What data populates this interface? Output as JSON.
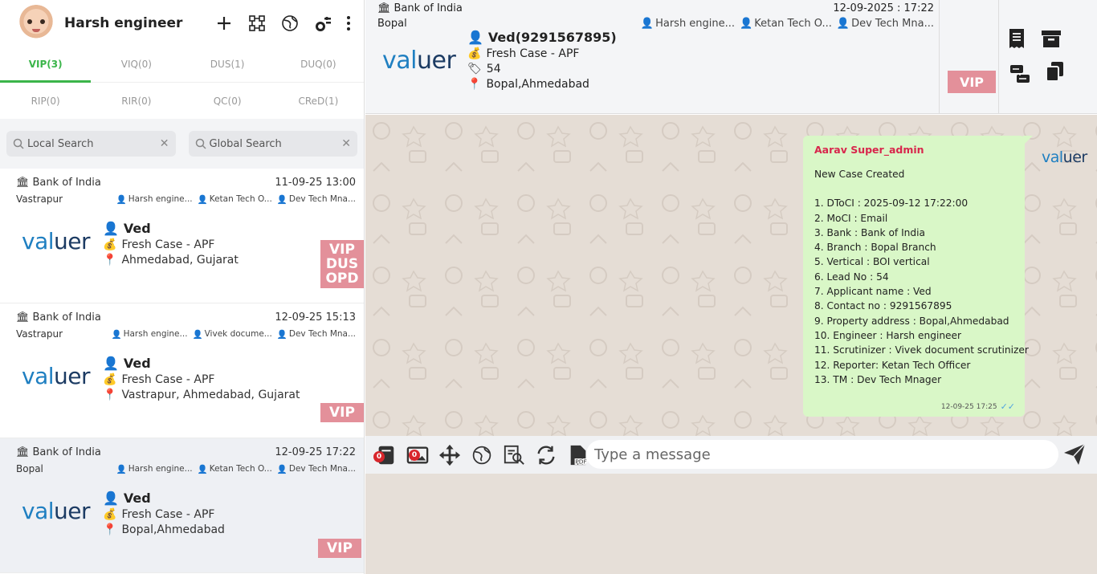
{
  "user": {
    "name": "Harsh engineer"
  },
  "tabs_row1": [
    {
      "label": "VIP(3)",
      "active": true
    },
    {
      "label": "VIQ(0)"
    },
    {
      "label": "DUS(1)"
    },
    {
      "label": "DUQ(0)"
    }
  ],
  "tabs_row2": [
    {
      "label": "RIP(0)"
    },
    {
      "label": "RIR(0)"
    },
    {
      "label": "QC(0)"
    },
    {
      "label": "CReD(1)"
    }
  ],
  "search": {
    "local": "Local Search",
    "global": "Global Search"
  },
  "logo": {
    "part1": "val",
    "part2": "uer"
  },
  "cases": [
    {
      "bank": "Bank of India",
      "time": "11-09-25 13:00",
      "branch": "Vastrapur",
      "people": [
        "Harsh engine...",
        "Ketan Tech O...",
        "Dev Tech Mna..."
      ],
      "name": "Ved",
      "case_type": "Fresh Case - APF",
      "location": "Ahmedabad, Gujarat",
      "tags": [
        "VIP",
        "DUS",
        "OPD"
      ]
    },
    {
      "bank": "Bank of India",
      "time": "12-09-25 15:13",
      "branch": "Vastrapur",
      "people": [
        "Harsh engine...",
        "Vivek docume...",
        "Dev Tech Mna..."
      ],
      "name": "Ved",
      "case_type": "Fresh Case - APF",
      "location": "Vastrapur, Ahmedabad, Gujarat",
      "tags": [
        "VIP"
      ]
    },
    {
      "bank": "Bank of India",
      "time": "12-09-25 17:22",
      "branch": "Bopal",
      "people": [
        "Harsh engine...",
        "Ketan Tech O...",
        "Dev Tech Mna..."
      ],
      "name": "Ved",
      "case_type": "Fresh Case - APF",
      "location": "Bopal,Ahmedabad",
      "tags": [
        "VIP"
      ]
    }
  ],
  "header": {
    "bank": "Bank of India",
    "datetime": "12-09-2025 : 17:22",
    "branch": "Bopal",
    "people": [
      "Harsh engine...",
      "Ketan Tech O...",
      "Dev Tech Mna..."
    ],
    "name": "Ved(9291567895)",
    "case_type": "Fresh Case - APF",
    "lead": "54",
    "location": "Bopal,Ahmedabad",
    "tag": "VIP"
  },
  "message": {
    "sender": "Aarav Super_admin",
    "lines": [
      "New Case Created",
      "",
      "1. DToCI : 2025-09-12 17:22:00",
      "2. MoCI : Email",
      "3. Bank : Bank of India",
      "4. Branch : Bopal Branch",
      "5. Vertical : BOI vertical",
      "6. Lead No : 54",
      "7. Applicant name : Ved",
      "8. Contact no : 9291567895",
      "9. Property address : Bopal,Ahmedabad",
      "10. Engineer : Harsh engineer",
      "11. Scrutinizer : Vivek document scrutinizer",
      "12. Reporter: Ketan Tech Officer",
      "13. TM : Dev Tech Mnager"
    ],
    "time": "12-09-25 17:25"
  },
  "composer": {
    "placeholder": "Type a message",
    "badge1": "0",
    "badge2": "0"
  },
  "colors": {
    "accent": "#3bb54a",
    "tag": "#e3909a",
    "bubble": "#d9f7c7",
    "sender": "#d8264c"
  }
}
